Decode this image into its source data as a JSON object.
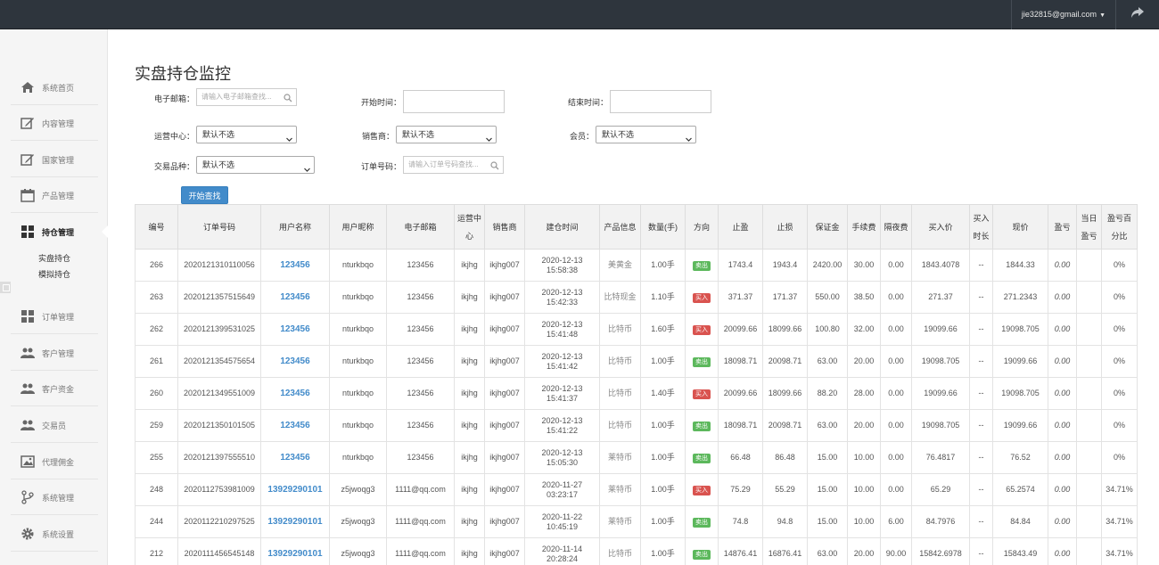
{
  "topbar": {
    "user_email": "jie32815@gmail.com"
  },
  "sidebar": {
    "items": [
      {
        "label": "系统首页",
        "icon": "home-icon"
      },
      {
        "label": "内容管理",
        "icon": "edit-icon"
      },
      {
        "label": "国家管理",
        "icon": "edit-icon"
      },
      {
        "label": "产品管理",
        "icon": "calendar-icon"
      },
      {
        "label": "持仓管理",
        "icon": "grid-icon"
      },
      {
        "label": "订单管理",
        "icon": "grid-icon"
      },
      {
        "label": "客户管理",
        "icon": "users-icon"
      },
      {
        "label": "客户资金",
        "icon": "users-icon"
      },
      {
        "label": "交易员",
        "icon": "users-icon"
      },
      {
        "label": "代理佣金",
        "icon": "picture-icon"
      },
      {
        "label": "系统管理",
        "icon": "branch-icon"
      },
      {
        "label": "系统设置",
        "icon": "gear-icon"
      }
    ],
    "subitems": [
      "实盘持仓",
      "模拟持仓"
    ]
  },
  "page": {
    "title": "实盘持仓监控"
  },
  "filters": {
    "email_label": "电子邮箱：",
    "email_placeholder": "请输入电子邮箱查找...",
    "start_label": "开始时间：",
    "end_label": "结束时间：",
    "ops_label": "运营中心：",
    "ops_value": "默认不选",
    "seller_label": "销售商：",
    "seller_value": "默认不选",
    "member_label": "会员：",
    "member_value": "默认不选",
    "variety_label": "交易品种：",
    "variety_value": "默认不选",
    "order_label": "订单号码：",
    "order_placeholder": "请输入订单号码查找...",
    "search_button": "开始查找"
  },
  "table": {
    "headers": [
      "编号",
      "订单号码",
      "用户名称",
      "用户昵称",
      "电子邮箱",
      "运营中心",
      "销售商",
      "建仓时间",
      "产品信息",
      "数量(手)",
      "方向",
      "止盈",
      "止损",
      "保证金",
      "手续费",
      "隔夜费",
      "买入价",
      "买入时长",
      "现价",
      "盈亏",
      "当日盈亏",
      "盈亏百分比"
    ],
    "rows": [
      [
        "266",
        "2020121310110056",
        "123456",
        "nturkbqo",
        "123456",
        "ikjhg",
        "ikjhg007",
        "2020-12-13 15:58:38",
        "美黄金",
        "1.00手",
        "卖出",
        "1743.4",
        "1943.4",
        "2420.00",
        "30.00",
        "0.00",
        "1843.4078",
        "--",
        "1844.33",
        "0.00",
        "",
        "0%"
      ],
      [
        "263",
        "2020121357515649",
        "123456",
        "nturkbqo",
        "123456",
        "ikjhg",
        "ikjhg007",
        "2020-12-13 15:42:33",
        "比特现金",
        "1.10手",
        "买入",
        "371.37",
        "171.37",
        "550.00",
        "38.50",
        "0.00",
        "271.37",
        "--",
        "271.2343",
        "0.00",
        "",
        "0%"
      ],
      [
        "262",
        "2020121399531025",
        "123456",
        "nturkbqo",
        "123456",
        "ikjhg",
        "ikjhg007",
        "2020-12-13 15:41:48",
        "比特币",
        "1.60手",
        "买入",
        "20099.66",
        "18099.66",
        "100.80",
        "32.00",
        "0.00",
        "19099.66",
        "--",
        "19098.705",
        "0.00",
        "",
        "0%"
      ],
      [
        "261",
        "2020121354575654",
        "123456",
        "nturkbqo",
        "123456",
        "ikjhg",
        "ikjhg007",
        "2020-12-13 15:41:42",
        "比特币",
        "1.00手",
        "卖出",
        "18098.71",
        "20098.71",
        "63.00",
        "20.00",
        "0.00",
        "19098.705",
        "--",
        "19099.66",
        "0.00",
        "",
        "0%"
      ],
      [
        "260",
        "2020121349551009",
        "123456",
        "nturkbqo",
        "123456",
        "ikjhg",
        "ikjhg007",
        "2020-12-13 15:41:37",
        "比特币",
        "1.40手",
        "买入",
        "20099.66",
        "18099.66",
        "88.20",
        "28.00",
        "0.00",
        "19099.66",
        "--",
        "19098.705",
        "0.00",
        "",
        "0%"
      ],
      [
        "259",
        "2020121350101505",
        "123456",
        "nturkbqo",
        "123456",
        "ikjhg",
        "ikjhg007",
        "2020-12-13 15:41:22",
        "比特币",
        "1.00手",
        "卖出",
        "18098.71",
        "20098.71",
        "63.00",
        "20.00",
        "0.00",
        "19098.705",
        "--",
        "19099.66",
        "0.00",
        "",
        "0%"
      ],
      [
        "255",
        "2020121397555510",
        "123456",
        "nturkbqo",
        "123456",
        "ikjhg",
        "ikjhg007",
        "2020-12-13 15:05:30",
        "莱特币",
        "1.00手",
        "卖出",
        "66.48",
        "86.48",
        "15.00",
        "10.00",
        "0.00",
        "76.4817",
        "--",
        "76.52",
        "0.00",
        "",
        "0%"
      ],
      [
        "248",
        "2020112753981009",
        "13929290101",
        "z5jwoqg3",
        "1111@qq.com",
        "ikjhg",
        "ikjhg007",
        "2020-11-27 03:23:17",
        "莱特币",
        "1.00手",
        "买入",
        "75.29",
        "55.29",
        "15.00",
        "10.00",
        "0.00",
        "65.29",
        "--",
        "65.2574",
        "0.00",
        "",
        "34.71%"
      ],
      [
        "244",
        "2020112210297525",
        "13929290101",
        "z5jwoqg3",
        "1111@qq.com",
        "ikjhg",
        "ikjhg007",
        "2020-11-22 10:45:19",
        "莱特币",
        "1.00手",
        "卖出",
        "74.8",
        "94.8",
        "15.00",
        "10.00",
        "6.00",
        "84.7976",
        "--",
        "84.84",
        "0.00",
        "",
        "34.71%"
      ],
      [
        "212",
        "2020111456545148",
        "13929290101",
        "z5jwoqg3",
        "1111@qq.com",
        "ikjhg",
        "ikjhg007",
        "2020-11-14 20:28:24",
        "比特币",
        "1.00手",
        "卖出",
        "14876.41",
        "16876.41",
        "63.00",
        "20.00",
        "90.00",
        "15842.6978",
        "--",
        "15843.49",
        "0.00",
        "",
        "34.71%"
      ]
    ]
  }
}
